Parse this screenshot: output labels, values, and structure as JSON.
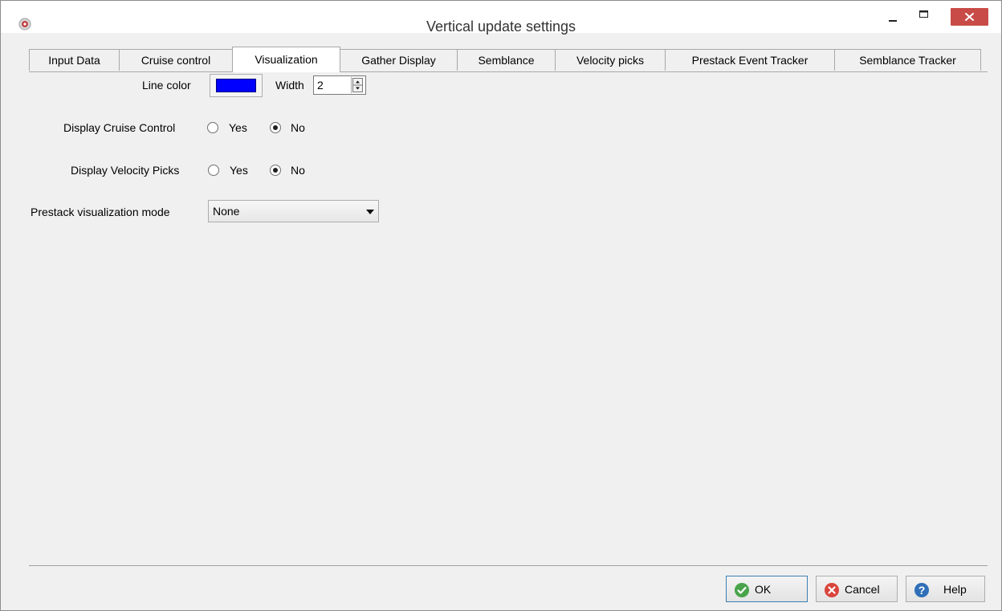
{
  "window": {
    "title": "Vertical update settings",
    "icon": "app-icon",
    "controls": {
      "minimize": "minimize-icon",
      "maximize": "maximize-icon",
      "close": "close-icon"
    }
  },
  "tabs": [
    {
      "label": "Input Data",
      "active": false
    },
    {
      "label": "Cruise control",
      "active": false
    },
    {
      "label": "Visualization",
      "active": true
    },
    {
      "label": "Gather Display",
      "active": false
    },
    {
      "label": "Semblance",
      "active": false
    },
    {
      "label": "Velocity picks",
      "active": false
    },
    {
      "label": "Prestack Event Tracker",
      "active": false
    },
    {
      "label": "Semblance Tracker",
      "active": false
    }
  ],
  "visualization": {
    "line_color_label": "Line color",
    "line_color_value": "#0000ff",
    "width_label": "Width",
    "width_value": "2",
    "display_cruise_control": {
      "label": "Display Cruise Control",
      "options": [
        "Yes",
        "No"
      ],
      "selected": "No"
    },
    "display_velocity_picks": {
      "label": "Display Velocity Picks",
      "options": [
        "Yes",
        "No"
      ],
      "selected": "No"
    },
    "prestack_mode": {
      "label": "Prestack visualization mode",
      "selected": "None"
    }
  },
  "footer": {
    "ok_label": "OK",
    "cancel_label": "Cancel",
    "help_label": "Help"
  },
  "colors": {
    "close_button": "#c84b47",
    "ok_icon": "#4aa34a",
    "cancel_icon": "#d9453c",
    "help_icon": "#2f6fb8"
  }
}
